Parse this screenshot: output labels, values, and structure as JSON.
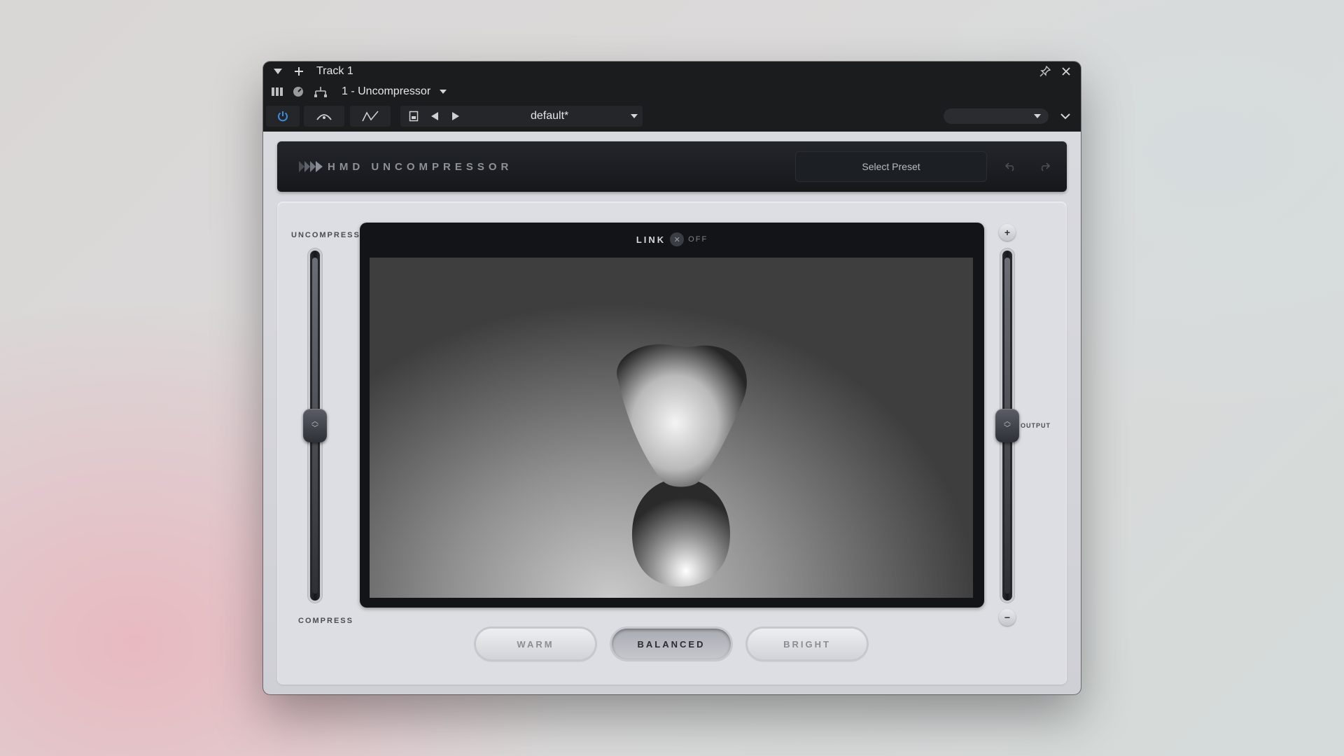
{
  "host": {
    "track_name": "Track 1",
    "insert_name": "1 - Uncompressor",
    "preset_name": "default*",
    "secondary_dropdown": ""
  },
  "plugin": {
    "brand": "HMD UNCOMPRESSOR",
    "preset_button": "Select Preset",
    "link": {
      "label": "LINK",
      "state": "OFF"
    },
    "left_slider": {
      "top_label": "UNCOMPRESS",
      "bottom_label": "COMPRESS",
      "value": 0.5
    },
    "right_slider": {
      "label": "OUTPUT",
      "value": 0.5
    },
    "tone_buttons": [
      {
        "label": "WARM",
        "active": false
      },
      {
        "label": "BALANCED",
        "active": true
      },
      {
        "label": "BRIGHT",
        "active": false
      }
    ]
  },
  "colors": {
    "power_active": "#3d8fe6",
    "header_bg": "#1b1e23",
    "panel_bg": "#dddee3"
  },
  "icons": [
    "menu-triangle-icon",
    "add-icon",
    "pin-icon",
    "close-icon",
    "mixer-icon",
    "meter-icon",
    "routing-icon",
    "dropdown-arrow-icon",
    "power-icon",
    "automation-icon",
    "envelope-icon",
    "save-icon",
    "prev-arrow-icon",
    "next-arrow-icon",
    "expand-chevron-icon",
    "logo-icon",
    "undo-icon",
    "redo-icon",
    "plus-icon",
    "minus-icon"
  ]
}
